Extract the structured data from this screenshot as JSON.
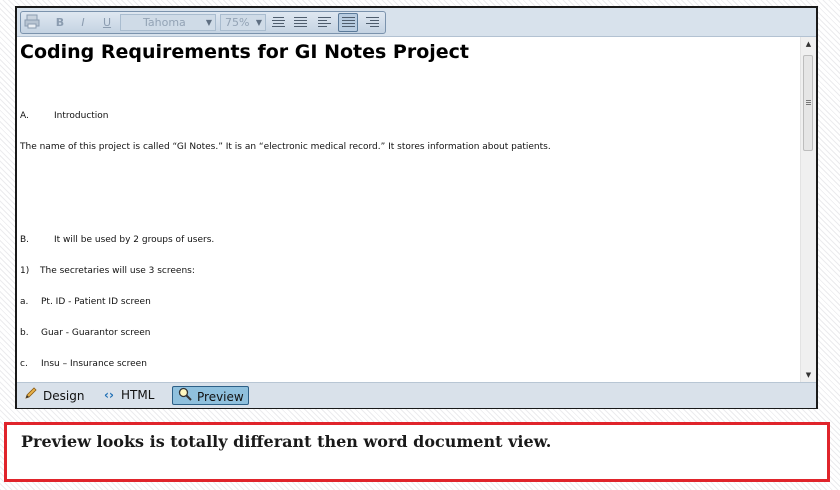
{
  "toolbar": {
    "font_name": "Tahoma",
    "zoom": "75%",
    "bold_label": "B",
    "italic_label": "I",
    "underline_label": "U",
    "icons": [
      "print-icon",
      "bold-icon",
      "italic-icon",
      "underline-icon",
      "align-center-icon",
      "justify-icon",
      "align-left-icon",
      "align-justify-active-icon",
      "align-right-icon"
    ]
  },
  "document": {
    "title": "Coding Requirements for GI Notes Project",
    "paragraphs": [
      {
        "num": "A.",
        "text": "Introduction"
      },
      {
        "num": "",
        "text": "The name of this project is called “GI Notes.”  It is an “electronic medical record.”  It stores information about patients."
      },
      {
        "num": "B.",
        "text": "It will be used by 2 groups of users."
      },
      {
        "num": "1)",
        "text": "The secretaries will use 3 screens:"
      },
      {
        "num": "a.",
        "text": "Pt. ID  - Patient ID screen"
      },
      {
        "num": "b.",
        "text": "Guar  - Guarantor screen"
      },
      {
        "num": "c.",
        "text": "Insu – Insurance screen"
      }
    ]
  },
  "modes": [
    {
      "label": "Design",
      "icon": "pencil-icon",
      "active": false
    },
    {
      "label": "HTML",
      "icon": "code-brackets-icon",
      "active": false
    },
    {
      "label": "Preview",
      "icon": "magnifier-icon",
      "active": true
    }
  ],
  "note": {
    "text": "Preview looks is totally differant then word document view."
  },
  "colors": {
    "toolbar_bg": "#d8e2ec",
    "active_mode_bg": "#8fc0dd",
    "note_border": "#e0242b"
  }
}
